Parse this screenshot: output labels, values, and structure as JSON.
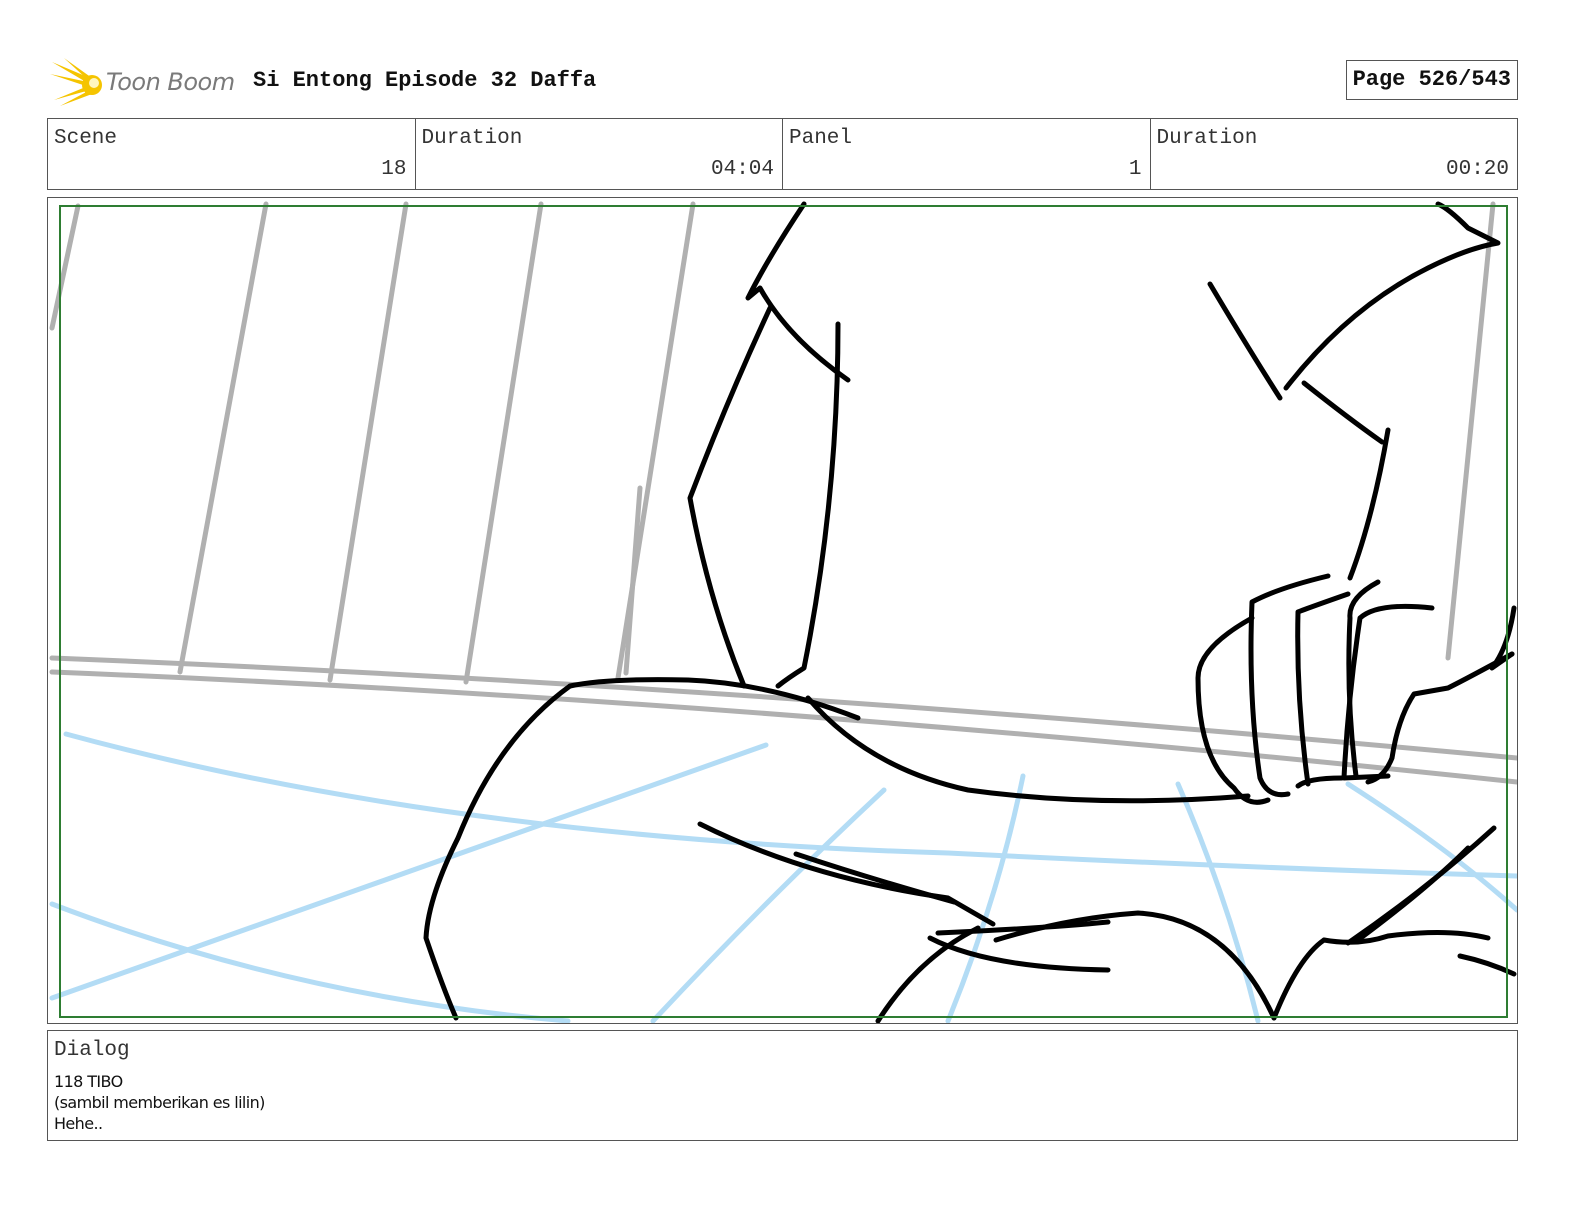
{
  "header": {
    "logo_text": "Toon Boom",
    "title": "Si Entong Episode 32 Daffa",
    "page": "Page 526/543"
  },
  "info": {
    "scene_label": "Scene",
    "scene_value": "18",
    "scene_duration_label": "Duration",
    "scene_duration_value": "04:04",
    "panel_label": "Panel",
    "panel_value": "1",
    "panel_duration_label": "Duration",
    "panel_duration_value": "00:20"
  },
  "dialog": {
    "label": "Dialog",
    "lines": [
      "118 TIBO",
      "(sambil memberikan es lilin)",
      "Hehe.."
    ]
  },
  "colors": {
    "safe_frame": "#2e7d32",
    "sketch_line": "#000000",
    "background_line": "#b0b0b0",
    "guide_line": "#b3dcf5",
    "logo_star": "#f5c400"
  }
}
